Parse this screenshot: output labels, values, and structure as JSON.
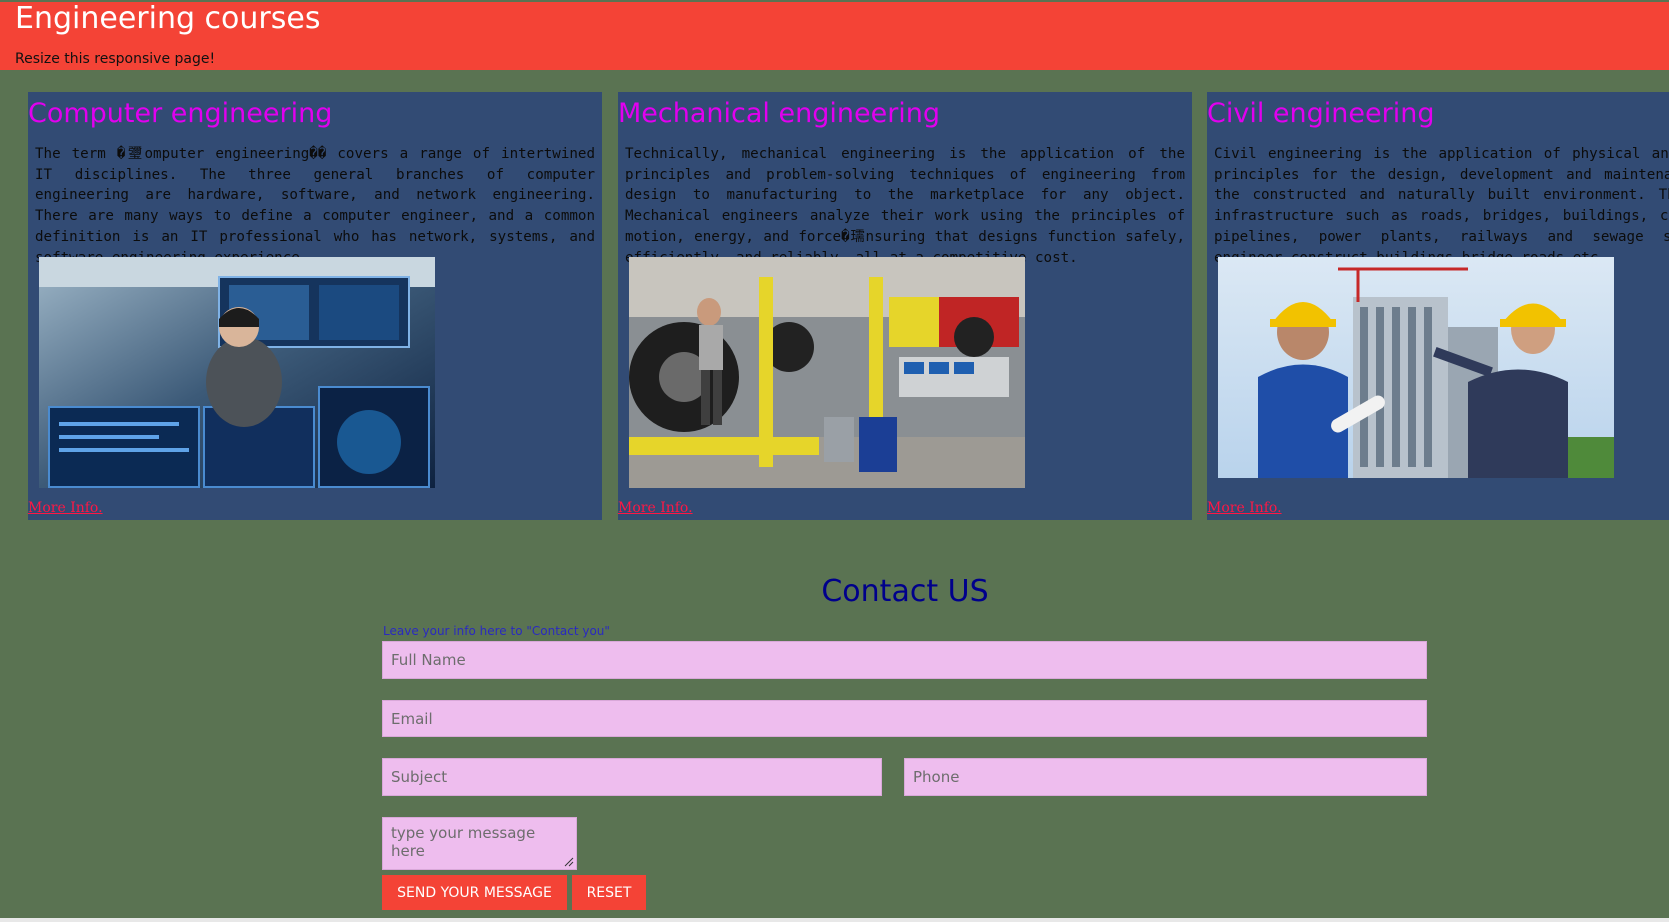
{
  "header": {
    "title": "Engineering courses",
    "subtitle": "Resize this responsive page!"
  },
  "cards": [
    {
      "title": "Computer engineering",
      "text": "The term �瓕omputer engineering�� covers a range of intertwined IT disciplines. The three general branches of computer engineering are hardware, software, and network engineering. There are many ways to define a computer engineer, and a common definition is an IT professional who has network, systems, and software engineering experience.",
      "link": "More Info."
    },
    {
      "title": "Mechanical engineering",
      "text": "Technically, mechanical engineering is the application of the principles and problem-solving techniques of engineering from design to manufacturing to the marketplace for any object. Mechanical engineers analyze their work using the principles of motion, energy, and force�瓀nsuring that designs function safely, efficiently, and reliably, all at a competitive cost.",
      "link": "More Info."
    },
    {
      "title": "Civil engineering",
      "text": "Civil engineering is the application of physical and scientific principles for the design, development and maintenance of both the constructed and naturally built environment. This includes infrastructure such as roads, bridges, buildings, canals, dams, pipelines, power plants, railways and sewage systems,civil engineer construct buildings,bridge,roads etc.",
      "link": "More Info."
    }
  ],
  "contact": {
    "title": "Contact US",
    "label": "Leave your info here to \"Contact you\"",
    "full_name_placeholder": "Full Name",
    "email_placeholder": "Email",
    "subject_placeholder": "Subject",
    "phone_placeholder": "Phone",
    "message_placeholder": "type your message here",
    "send_label": "SEND YOUR MESSAGE",
    "reset_label": "RESET"
  },
  "colors": {
    "header_bg": "#f44336",
    "page_bg": "#5a7352",
    "card_bg": "#324b74",
    "card_title": "#e100ef",
    "field_bg": "#eebdee",
    "contact_title": "#00008b"
  },
  "icons": {
    "photo1": "engineer-with-monitors-photo",
    "photo2": "tractor-factory-photo",
    "photo3": "construction-engineers-photo",
    "grip": "resize-grip-icon"
  }
}
